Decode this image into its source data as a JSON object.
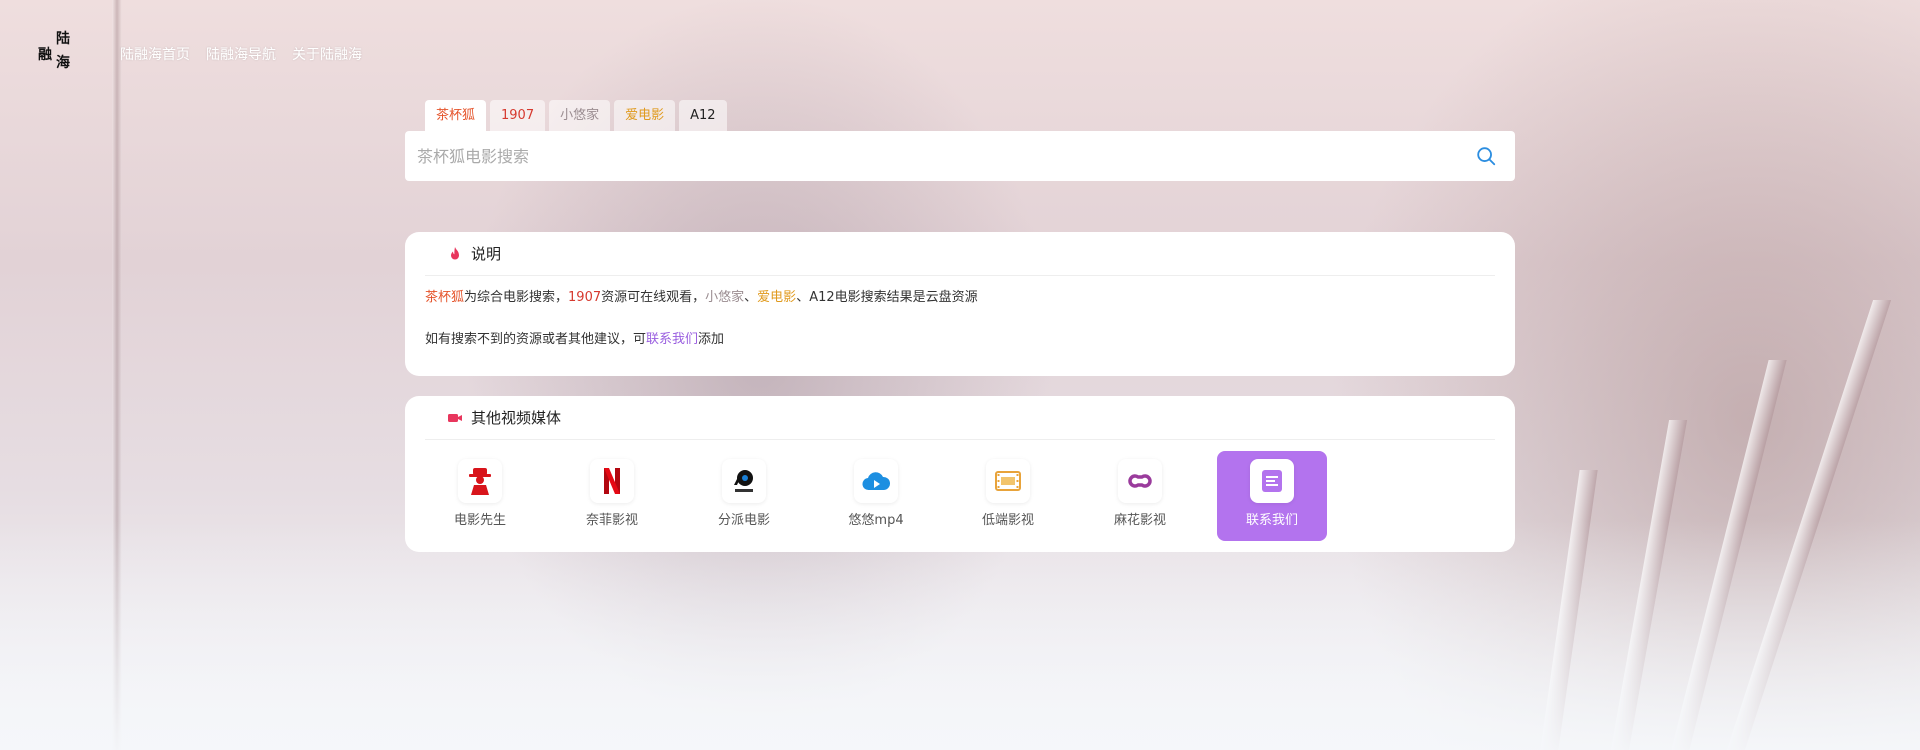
{
  "logo": {
    "chars": [
      "陆",
      "融",
      "海"
    ]
  },
  "nav": {
    "items": [
      "陆融海首页",
      "陆融海导航",
      "关于陆融海"
    ]
  },
  "tabs": [
    {
      "label": "茶杯狐",
      "color": "#e5542b"
    },
    {
      "label": "1907",
      "color": "#d63a2f"
    },
    {
      "label": "小悠家",
      "color": "#9a8c90"
    },
    {
      "label": "爱电影",
      "color": "#e09a1e"
    },
    {
      "label": "A12",
      "color": "#222222"
    }
  ],
  "search": {
    "placeholder": "茶杯狐电影搜索",
    "value": ""
  },
  "notice": {
    "title": "说明",
    "line1": {
      "t1": "茶杯狐",
      "t2": "为综合电影搜索，",
      "t3": "1907",
      "t4": "资源可在线观看，",
      "t5": "小悠家",
      "t6": "、",
      "t7": "爱电影",
      "t8": "、A12电影搜索结果是云盘资源"
    },
    "line2": {
      "t1": "如有搜索不到的资源或者其他建议，可",
      "t2": "联系我们",
      "t3": "添加"
    }
  },
  "media": {
    "title": "其他视频媒体",
    "items": [
      {
        "label": "电影先生",
        "icon": "mr-movie-icon"
      },
      {
        "label": "奈菲影视",
        "icon": "netflix-icon"
      },
      {
        "label": "分派电影",
        "icon": "clapper-icon"
      },
      {
        "label": "悠悠mp4",
        "icon": "cloud-play-icon"
      },
      {
        "label": "低端影视",
        "icon": "film-strip-icon"
      },
      {
        "label": "麻花影视",
        "icon": "link-icon"
      },
      {
        "label": "联系我们",
        "icon": "note-icon"
      }
    ]
  },
  "colors": {
    "accent": "#b373ee",
    "link": "#9a5fe0",
    "icon_red": "#e8365d",
    "search_icon": "#2b8de0"
  }
}
